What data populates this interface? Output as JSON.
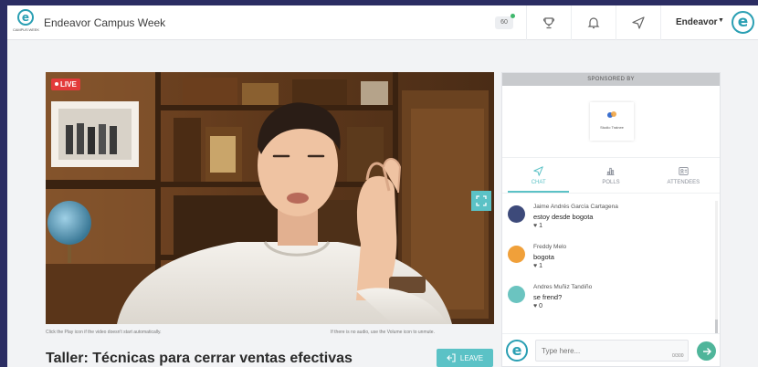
{
  "topbar": {
    "logo_caption": "CAMPUS WEEK",
    "logo_letter": "e",
    "title": "Endeavor Campus Week",
    "goal_badge": "60",
    "user_name": "Endeavor",
    "user_caret": "▼",
    "avatar_letter": "e",
    "icons": [
      "trophy-icon",
      "bell-icon",
      "paper-plane-icon"
    ]
  },
  "video": {
    "live_label": "LIVE",
    "hint_left": "Click the Play icon if the video doesn't start automatically.",
    "hint_right": "If there is no audio, use the Volume icon to unmute."
  },
  "session": {
    "title": "Taller: Técnicas para cerrar ventas efectivas",
    "leave_label": "LEAVE"
  },
  "sidebar": {
    "sponsored_label": "SPONSORED BY",
    "sponsor_caption": "Studio Trainee",
    "tabs": [
      {
        "label": "CHAT",
        "icon": "paper-plane-icon",
        "active": true
      },
      {
        "label": "POLLS",
        "icon": "poll-icon",
        "active": false
      },
      {
        "label": "ATTENDEES",
        "icon": "attendees-icon",
        "active": false
      }
    ],
    "messages": [
      {
        "author": "Jaime Andrés García Cartagena",
        "text": "estoy desde bogota",
        "likes": "1",
        "color": "#3d4a7a"
      },
      {
        "author": "Freddy Melo",
        "text": "bogota",
        "likes": "1",
        "color": "#f0a03a"
      },
      {
        "author": "Andres Muñiz Tandiño",
        "text": "se frend?",
        "likes": "0",
        "color": "#6bc4c0"
      }
    ],
    "input_placeholder": "Type here...",
    "char_count": "0/300",
    "me_letter": "e"
  },
  "colors": {
    "accent": "#5bc2c6",
    "live": "#e33a3a",
    "brand": "#2a9fb3",
    "background": "#2b2d63"
  }
}
